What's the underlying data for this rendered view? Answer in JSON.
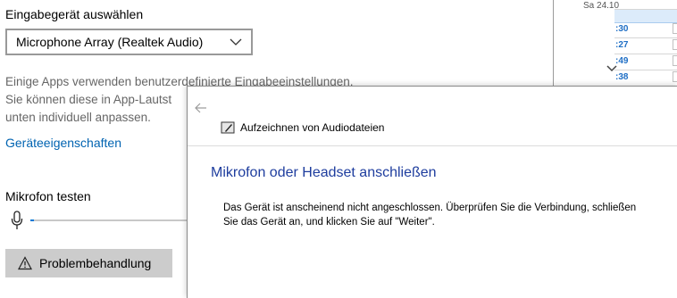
{
  "settings": {
    "input_device_heading": "Eingabegerät auswählen",
    "selected_device": "Microphone Array (Realtek Audio)",
    "info_lines": [
      "Einige Apps verwenden benutzerdefinierte Eingabeeinstellungen.",
      "Sie können diese in App-Lautst",
      "unten individuell anpassen."
    ],
    "device_properties_link": "Geräteeigenschaften",
    "mic_test_heading": "Mikrofon testen",
    "mic_level": 0.02,
    "troubleshoot_button": "Problembehandlung"
  },
  "mini_panel": {
    "date": "Sa 24.10",
    "times": [
      ":30",
      ":27",
      ":49",
      ":38"
    ]
  },
  "dialog": {
    "title": "Aufzeichnen von Audiodateien",
    "heading": "Mikrofon oder Headset anschließen",
    "body_lines": [
      "Das Gerät ist anscheinend nicht angeschlossen. Überprüfen Sie die Verbindung, schließen",
      "Sie das Gerät an, und klicken Sie auf \"Weiter\"."
    ]
  },
  "colors": {
    "accent": "#0078d7",
    "link": "#0063b1",
    "dialog_heading": "#1e3d9e",
    "button_bg": "#cccccc"
  },
  "icons": [
    "chevron-down-icon",
    "microphone-icon",
    "warning-icon",
    "back-arrow-icon",
    "app-icon"
  ]
}
